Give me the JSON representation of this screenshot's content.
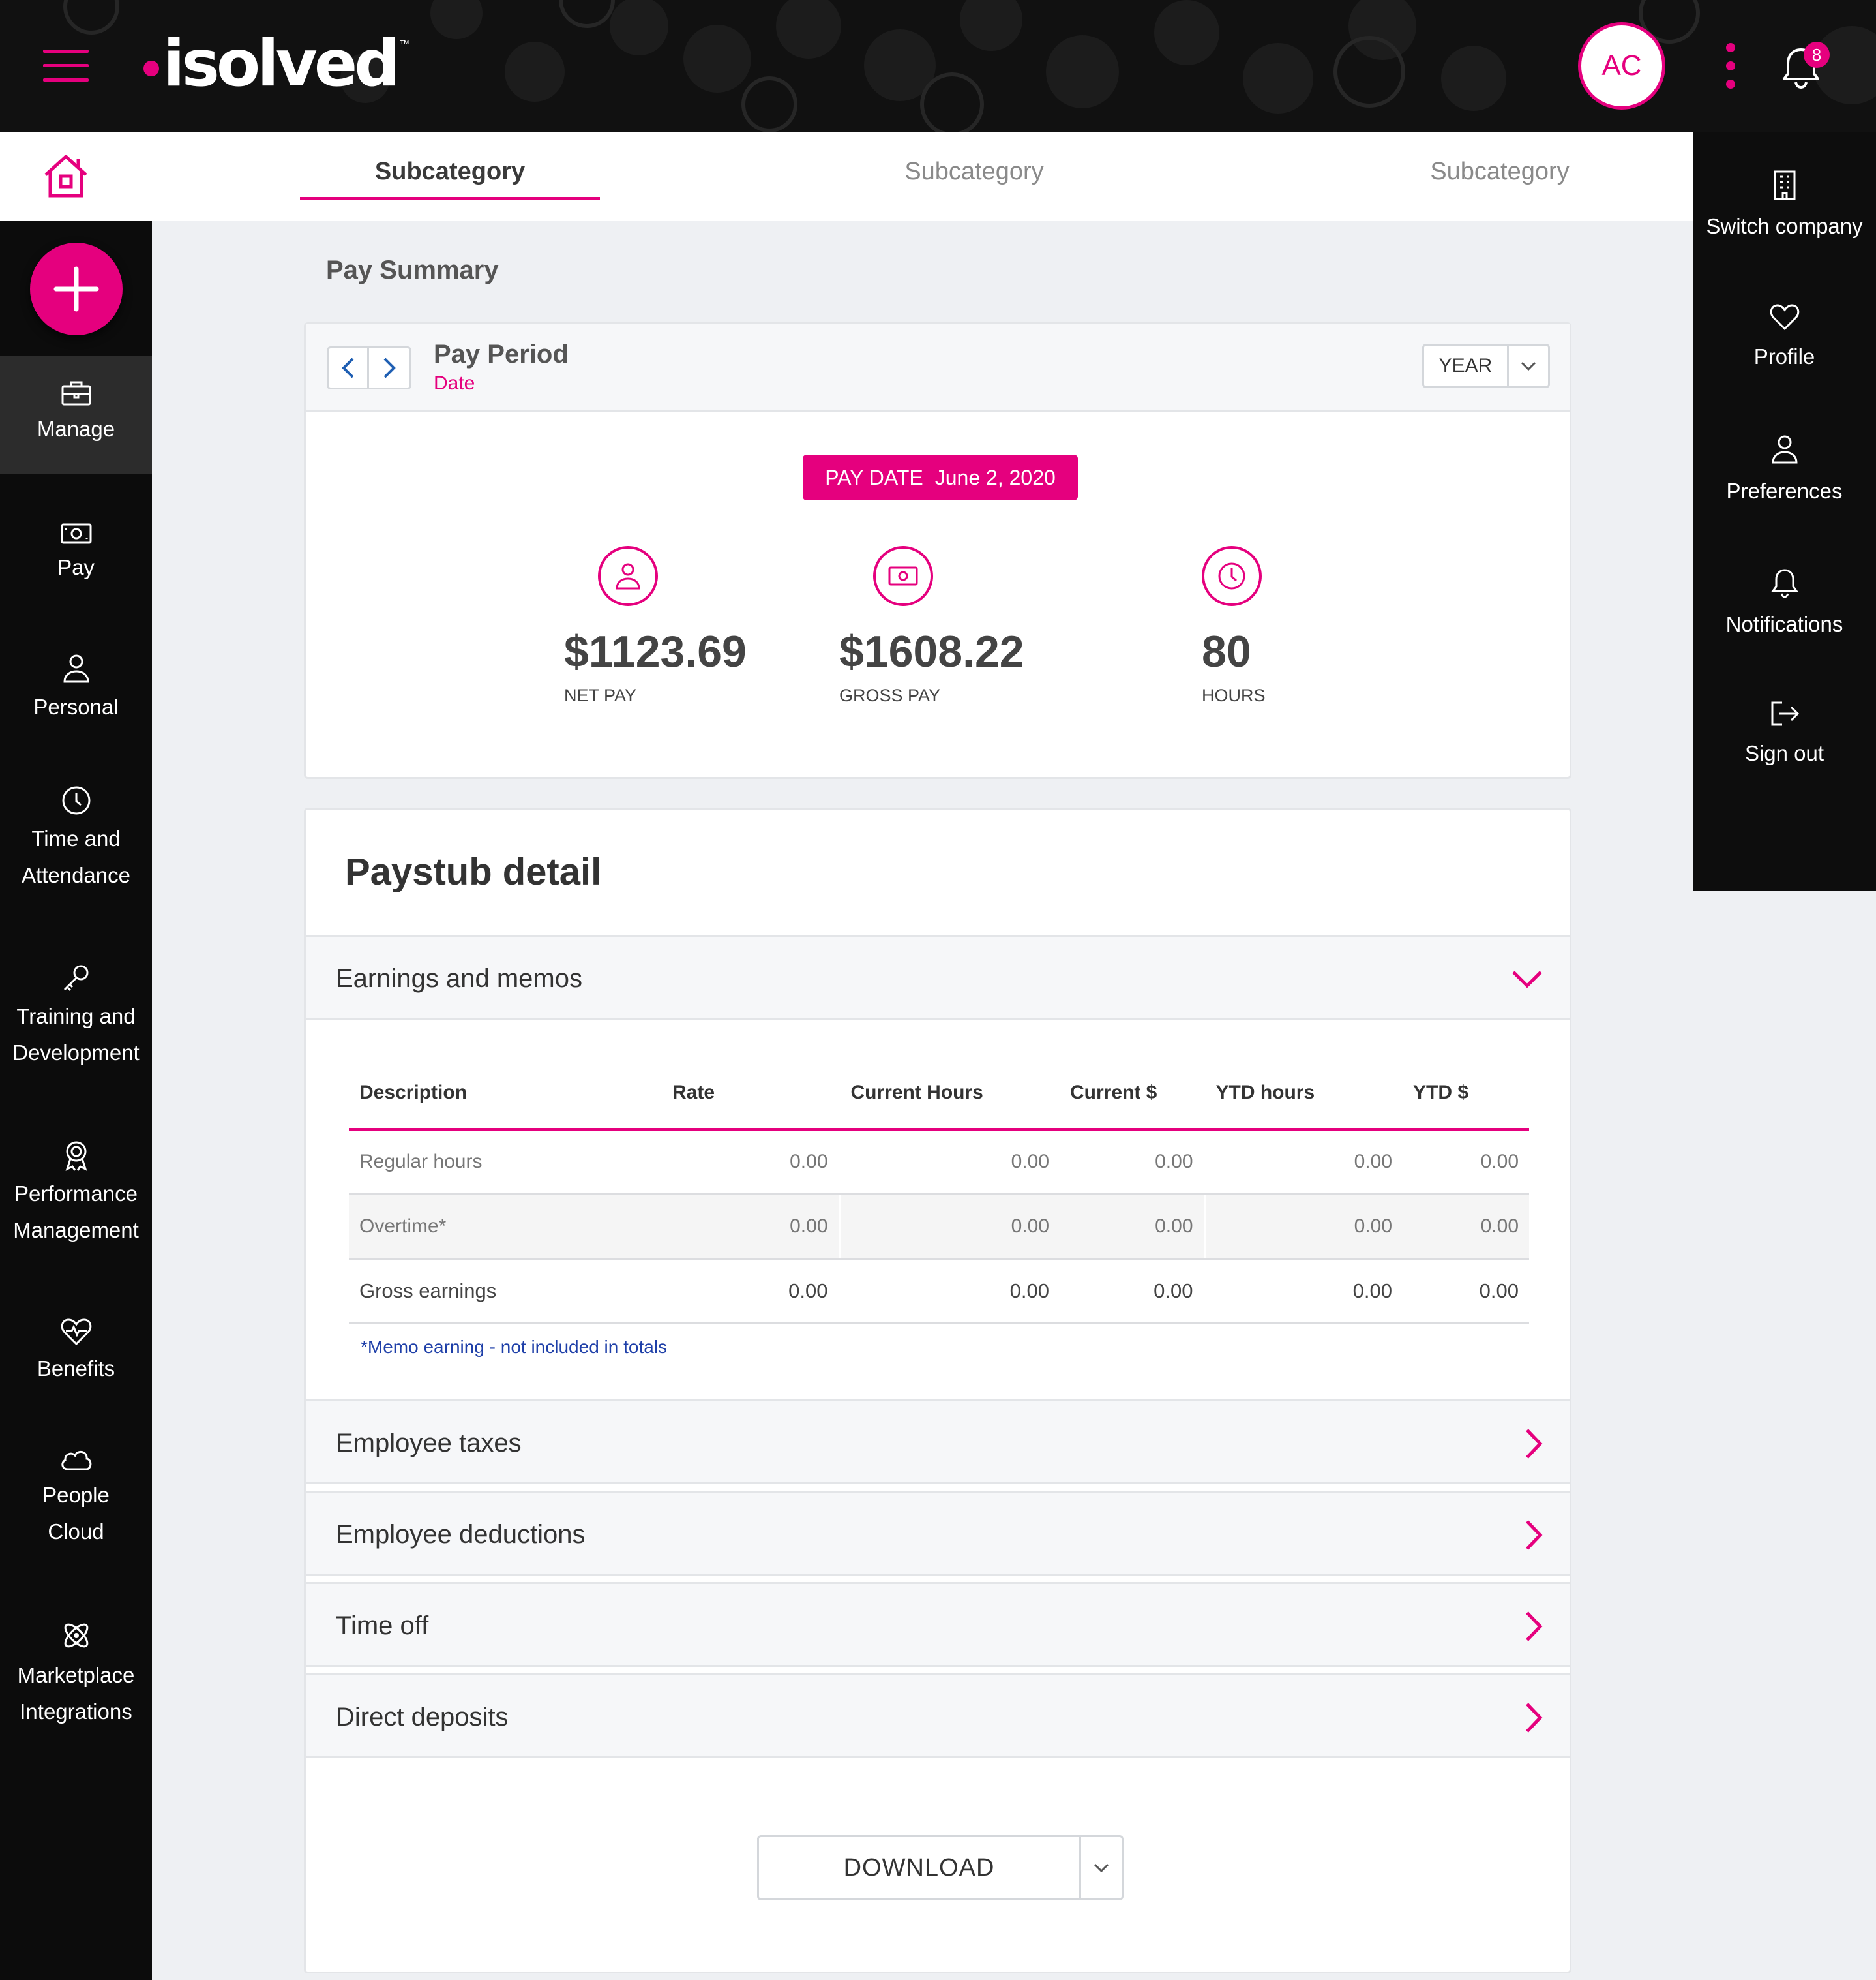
{
  "app": {
    "brand": "isolved",
    "trademark": "™"
  },
  "header": {
    "avatar_initials": "AC",
    "notification_count": "8"
  },
  "subnav": {
    "tabs": [
      {
        "label": "Subcategory",
        "active": true
      },
      {
        "label": "Subcategory",
        "active": false
      },
      {
        "label": "Subcategory",
        "active": false
      }
    ]
  },
  "sidebar": {
    "items": [
      {
        "label": "Manage",
        "icon": "briefcase-icon",
        "active": true
      },
      {
        "label": "Pay",
        "icon": "money-icon"
      },
      {
        "label": "Personal",
        "icon": "person-icon"
      },
      {
        "label_line1": "Time and",
        "label_line2": "Attendance",
        "icon": "clock-icon"
      },
      {
        "label_line1": "Training and",
        "label_line2": "Development",
        "icon": "key-icon"
      },
      {
        "label_line1": "Performance",
        "label_line2": "Management",
        "icon": "award-icon"
      },
      {
        "label": "Benefits",
        "icon": "heart-pulse-icon"
      },
      {
        "label_line1": "People",
        "label_line2": "Cloud",
        "icon": "cloud-icon"
      },
      {
        "label_line1": "Marketplace",
        "label_line2": "Integrations",
        "icon": "atom-icon"
      }
    ]
  },
  "drawer": {
    "items": [
      {
        "label": "Switch company",
        "icon": "building-icon"
      },
      {
        "label": "Profile",
        "icon": "heart-icon"
      },
      {
        "label": "Preferences",
        "icon": "person-icon"
      },
      {
        "label": "Notifications",
        "icon": "bell-icon"
      },
      {
        "label": "Sign out",
        "icon": "sign-out-icon"
      }
    ]
  },
  "pay_summary": {
    "title": "Pay Summary",
    "period_title": "Pay Period",
    "period_sub": "Date",
    "range_select": "YEAR",
    "pay_date_label": "PAY DATE",
    "pay_date_value": "June 2, 2020",
    "metrics": [
      {
        "value": "$1123.69",
        "label": "NET PAY",
        "icon": "person-icon"
      },
      {
        "value": "$1608.22",
        "label": "GROSS PAY",
        "icon": "money-icon"
      },
      {
        "value": "80",
        "label": "HOURS",
        "icon": "clock-icon"
      }
    ]
  },
  "paystub": {
    "title": "Paystub detail",
    "earnings_title": "Earnings and memos",
    "columns": [
      "Description",
      "Rate",
      "Current Hours",
      "Current $",
      "YTD hours",
      "YTD $"
    ],
    "rows": [
      [
        "Regular hours",
        "0.00",
        "0.00",
        "0.00",
        "0.00",
        "0.00"
      ],
      [
        "Overtime*",
        "0.00",
        "0.00",
        "0.00",
        "0.00",
        "0.00"
      ],
      [
        "Gross earnings",
        "0.00",
        "0.00",
        "0.00",
        "0.00",
        "0.00"
      ]
    ],
    "memo_note": "*Memo earning - not included in totals",
    "sections": [
      "Employee taxes",
      "Employee deductions",
      "Time off",
      "Direct deposits"
    ],
    "download_label": "DOWNLOAD"
  },
  "colors": {
    "accent": "#e5007e",
    "dark": "#0c0c0c",
    "link": "#1e3fa8"
  }
}
